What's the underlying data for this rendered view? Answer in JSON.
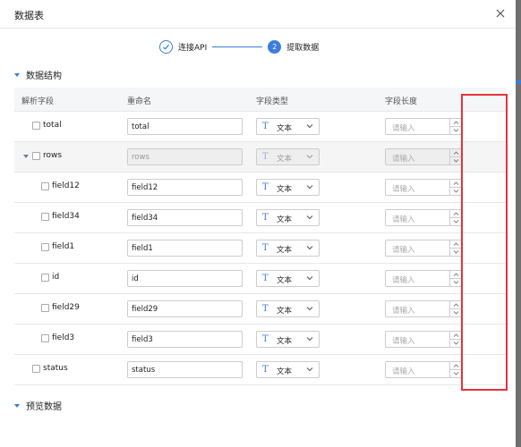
{
  "dialog": {
    "title": "数据表"
  },
  "steps": [
    {
      "number": "",
      "label": "连接API",
      "state": "done"
    },
    {
      "number": "2",
      "label": "提取数据",
      "state": "active"
    }
  ],
  "sections": {
    "structure": "数据结构",
    "preview": "预览数据"
  },
  "table": {
    "headers": {
      "field": "解析字段",
      "rename": "重命名",
      "type": "字段类型",
      "length": "字段长度"
    },
    "placeholder": "请输入",
    "rows": [
      {
        "name": "total",
        "rename": "total",
        "type": "文本",
        "level": 0,
        "expandable": false,
        "disabled": false
      },
      {
        "name": "rows",
        "rename": "rows",
        "type": "文本",
        "level": 0,
        "expandable": true,
        "disabled": true
      },
      {
        "name": "field12",
        "rename": "field12",
        "type": "文本",
        "level": 1,
        "expandable": false,
        "disabled": false
      },
      {
        "name": "field34",
        "rename": "field34",
        "type": "文本",
        "level": 1,
        "expandable": false,
        "disabled": false
      },
      {
        "name": "field1",
        "rename": "field1",
        "type": "文本",
        "level": 1,
        "expandable": false,
        "disabled": false
      },
      {
        "name": "id",
        "rename": "id",
        "type": "文本",
        "level": 1,
        "expandable": false,
        "disabled": false
      },
      {
        "name": "field29",
        "rename": "field29",
        "type": "文本",
        "level": 1,
        "expandable": false,
        "disabled": false
      },
      {
        "name": "field3",
        "rename": "field3",
        "type": "文本",
        "level": 1,
        "expandable": false,
        "disabled": false
      },
      {
        "name": "status",
        "rename": "status",
        "type": "文本",
        "level": 0,
        "expandable": false,
        "disabled": false
      }
    ]
  },
  "colors": {
    "accent": "#3b7ddd",
    "highlight": "#e8323c"
  },
  "icons": {
    "close": "close-icon",
    "check": "check-icon",
    "expand": "caret-down-icon",
    "type": "text-type-icon",
    "chevron": "chevron-down-icon"
  }
}
